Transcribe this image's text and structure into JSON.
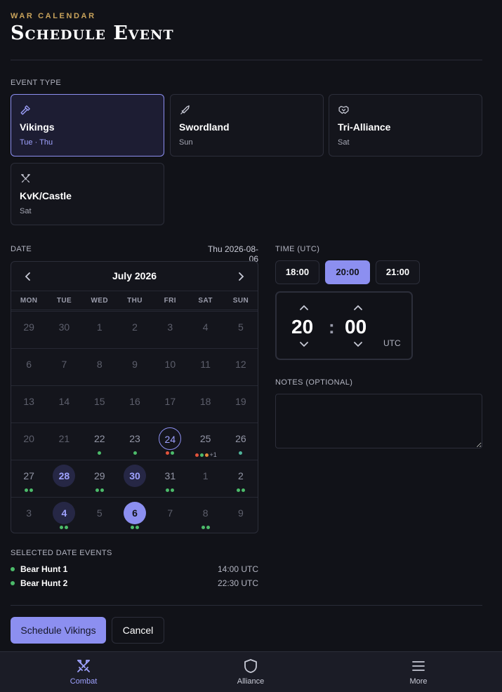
{
  "header": {
    "eyebrow": "WAR CALENDAR",
    "title": "Schedule Event"
  },
  "event_type": {
    "label": "EVENT TYPE",
    "options": [
      {
        "name": "Vikings",
        "days": "Tue · Thu",
        "icon": "hammer-icon",
        "selected": true
      },
      {
        "name": "Swordland",
        "days": "Sun",
        "icon": "sword-icon",
        "selected": false
      },
      {
        "name": "Tri-Alliance",
        "days": "Sat",
        "icon": "handshake-icon",
        "selected": false
      },
      {
        "name": "KvK/Castle",
        "days": "Sat",
        "icon": "crossed-swords-icon",
        "selected": false
      }
    ]
  },
  "date": {
    "label": "DATE",
    "selected_display": "Thu 2026-08-06",
    "calendar": {
      "month_label": "July 2026",
      "weekdays": [
        "MON",
        "TUE",
        "WED",
        "THU",
        "FRI",
        "SAT",
        "SUN"
      ],
      "weeks": [
        [
          {
            "d": "29",
            "state": "out"
          },
          {
            "d": "30",
            "state": "out"
          },
          {
            "d": "1",
            "state": "out"
          },
          {
            "d": "2",
            "state": "out"
          },
          {
            "d": "3",
            "state": "out"
          },
          {
            "d": "4",
            "state": "out"
          },
          {
            "d": "5",
            "state": "out"
          }
        ],
        [
          {
            "d": "6",
            "state": "out"
          },
          {
            "d": "7",
            "state": "out"
          },
          {
            "d": "8",
            "state": "out"
          },
          {
            "d": "9",
            "state": "out"
          },
          {
            "d": "10",
            "state": "out"
          },
          {
            "d": "11",
            "state": "out"
          },
          {
            "d": "12",
            "state": "out"
          }
        ],
        [
          {
            "d": "13",
            "state": "out"
          },
          {
            "d": "14",
            "state": "out"
          },
          {
            "d": "15",
            "state": "out"
          },
          {
            "d": "16",
            "state": "out"
          },
          {
            "d": "17",
            "state": "out"
          },
          {
            "d": "18",
            "state": "out"
          },
          {
            "d": "19",
            "state": "out"
          }
        ],
        [
          {
            "d": "20",
            "state": "out"
          },
          {
            "d": "21",
            "state": "out"
          },
          {
            "d": "22",
            "state": "evt",
            "dots": [
              "green"
            ]
          },
          {
            "d": "23",
            "state": "evt",
            "dots": [
              "green"
            ]
          },
          {
            "d": "24",
            "state": "today",
            "dots": [
              "red",
              "green"
            ]
          },
          {
            "d": "25",
            "state": "evt",
            "dots": [
              "red",
              "green",
              "orange"
            ],
            "more": "+1"
          },
          {
            "d": "26",
            "state": "evt",
            "dots": [
              "teal"
            ]
          }
        ],
        [
          {
            "d": "27",
            "state": "evt",
            "dots": [
              "green",
              "green"
            ]
          },
          {
            "d": "28",
            "state": "has"
          },
          {
            "d": "29",
            "state": "evt",
            "dots": [
              "green",
              "green"
            ]
          },
          {
            "d": "30",
            "state": "has"
          },
          {
            "d": "31",
            "state": "evt",
            "dots": [
              "green",
              "green"
            ]
          },
          {
            "d": "1",
            "state": "out"
          },
          {
            "d": "2",
            "state": "evt",
            "dots": [
              "green",
              "green"
            ]
          }
        ],
        [
          {
            "d": "3",
            "state": "out"
          },
          {
            "d": "4",
            "state": "has",
            "dots": [
              "green",
              "green"
            ]
          },
          {
            "d": "5",
            "state": "out"
          },
          {
            "d": "6",
            "state": "sel",
            "dots": [
              "green",
              "green"
            ]
          },
          {
            "d": "7",
            "state": "out"
          },
          {
            "d": "8",
            "state": "out",
            "dots": [
              "green",
              "green"
            ]
          },
          {
            "d": "9",
            "state": "out"
          }
        ]
      ]
    }
  },
  "time": {
    "label": "TIME (UTC)",
    "presets": [
      "18:00",
      "20:00",
      "21:00"
    ],
    "active_preset": "20:00",
    "hour": "20",
    "minute": "00",
    "separator": ":",
    "zone": "UTC"
  },
  "notes": {
    "label": "NOTES (OPTIONAL)",
    "value": ""
  },
  "selected_date_events": {
    "label": "SELECTED DATE EVENTS",
    "items": [
      {
        "name": "Bear Hunt 1",
        "time": "14:00 UTC"
      },
      {
        "name": "Bear Hunt 2",
        "time": "22:30 UTC"
      }
    ]
  },
  "actions": {
    "primary": "Schedule Vikings",
    "cancel": "Cancel"
  },
  "nav": {
    "items": [
      {
        "label": "Combat",
        "icon": "crossed-swords-icon",
        "active": true
      },
      {
        "label": "Alliance",
        "icon": "shield-icon",
        "active": false
      },
      {
        "label": "More",
        "icon": "menu-icon",
        "active": false
      }
    ]
  },
  "colors": {
    "accent": "#8c8ff0",
    "gold": "#c9a35b",
    "green": "#4cbb6a",
    "red": "#e0533b",
    "orange": "#e58a3a",
    "teal": "#4fb39a"
  }
}
